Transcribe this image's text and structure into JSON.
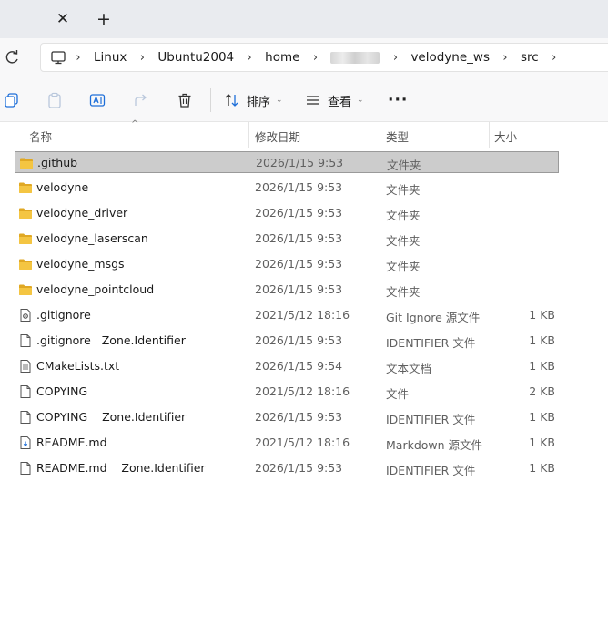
{
  "titlebar": {
    "close_glyph": "✕",
    "new_tab_glyph": "+"
  },
  "address": {
    "crumbs": [
      "Linux",
      "Ubuntu2004",
      "home",
      "velodyne_ws",
      "src"
    ],
    "separator": "›"
  },
  "toolbar": {
    "sort_label": "排序",
    "view_label": "查看",
    "caret": "⌄",
    "more": "···"
  },
  "columns": {
    "name": "名称",
    "date": "修改日期",
    "type": "类型",
    "size": "大小",
    "sort_glyph": "^"
  },
  "files": [
    {
      "name": ".github",
      "date": "2026/1/15 9:53",
      "type": "文件夹",
      "size": "",
      "icon": "folder-icon"
    },
    {
      "name": "velodyne",
      "date": "2026/1/15 9:53",
      "type": "文件夹",
      "size": "",
      "icon": "folder-icon"
    },
    {
      "name": "velodyne_driver",
      "date": "2026/1/15 9:53",
      "type": "文件夹",
      "size": "",
      "icon": "folder-icon"
    },
    {
      "name": "velodyne_laserscan",
      "date": "2026/1/15 9:53",
      "type": "文件夹",
      "size": "",
      "icon": "folder-icon"
    },
    {
      "name": "velodyne_msgs",
      "date": "2026/1/15 9:53",
      "type": "文件夹",
      "size": "",
      "icon": "folder-icon"
    },
    {
      "name": "velodyne_pointcloud",
      "date": "2026/1/15 9:53",
      "type": "文件夹",
      "size": "",
      "icon": "folder-icon"
    },
    {
      "name": ".gitignore",
      "date": "2021/5/12 18:16",
      "type": "Git Ignore 源文件",
      "size": "1 KB",
      "icon": "gear-file-icon"
    },
    {
      "name": ".gitignore   Zone.Identifier",
      "date": "2026/1/15 9:53",
      "type": "IDENTIFIER 文件",
      "size": "1 KB",
      "icon": "blank-file-icon"
    },
    {
      "name": "CMakeLists.txt",
      "date": "2026/1/15 9:54",
      "type": "文本文档",
      "size": "1 KB",
      "icon": "text-file-icon"
    },
    {
      "name": "COPYING",
      "date": "2021/5/12 18:16",
      "type": "文件",
      "size": "2 KB",
      "icon": "blank-file-icon"
    },
    {
      "name": "COPYING    Zone.Identifier",
      "date": "2026/1/15 9:53",
      "type": "IDENTIFIER 文件",
      "size": "1 KB",
      "icon": "blank-file-icon"
    },
    {
      "name": "README.md",
      "date": "2021/5/12 18:16",
      "type": "Markdown 源文件",
      "size": "1 KB",
      "icon": "markdown-file-icon"
    },
    {
      "name": "README.md    Zone.Identifier",
      "date": "2026/1/15 9:53",
      "type": "IDENTIFIER 文件",
      "size": "1 KB",
      "icon": "blank-file-icon"
    }
  ],
  "selected_index": 0,
  "colors": {
    "folder": "#f4c542",
    "folder_dark": "#e0a824",
    "accent": "#1e6fd9",
    "selection": "#cccccc"
  }
}
